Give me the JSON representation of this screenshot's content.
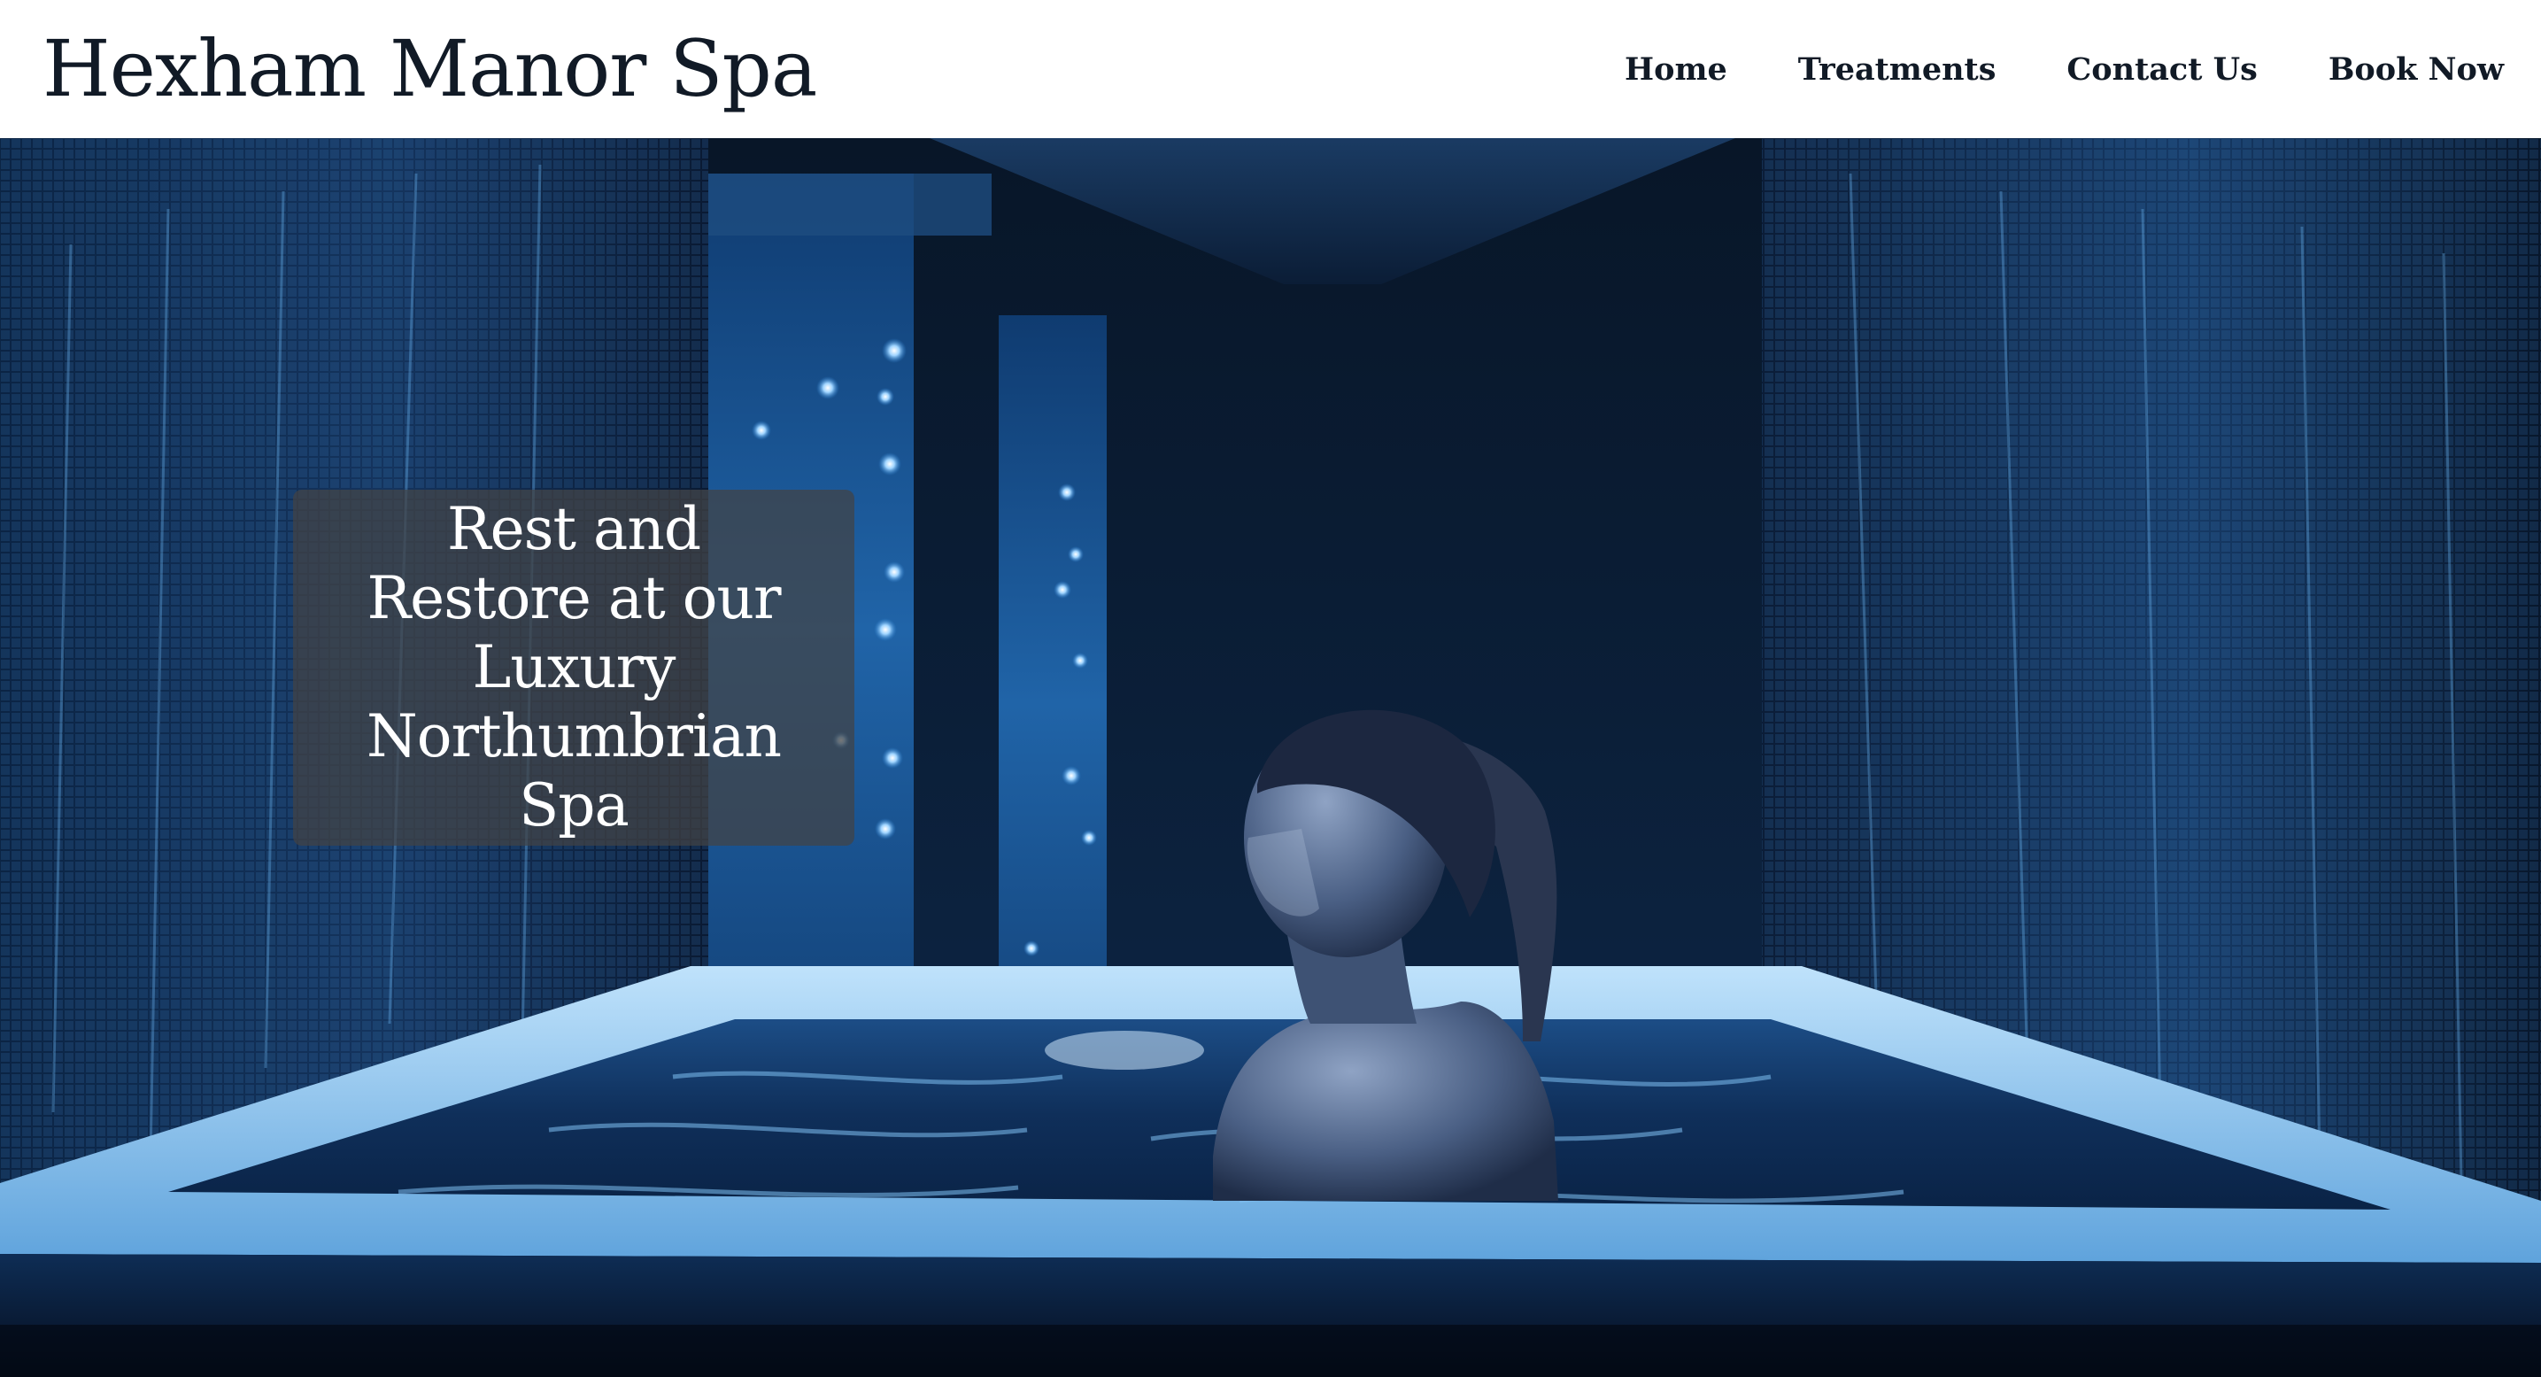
{
  "site": {
    "title": "Hexham Manor Spa"
  },
  "nav": {
    "items": [
      {
        "label": "Home"
      },
      {
        "label": "Treatments"
      },
      {
        "label": "Contact Us"
      },
      {
        "label": "Book Now"
      }
    ]
  },
  "hero": {
    "caption": "Rest and Restore at our Luxury Northumbrian Spa",
    "image_subject": "woman relaxing in a blue-lit spa bath"
  },
  "colors": {
    "header_bg": "#ffffff",
    "text_dark": "#111a26",
    "caption_box": "#424244",
    "caption_text": "#ffffff",
    "hero_dark": "#040b18",
    "hero_glow": "#4aa3e6"
  }
}
